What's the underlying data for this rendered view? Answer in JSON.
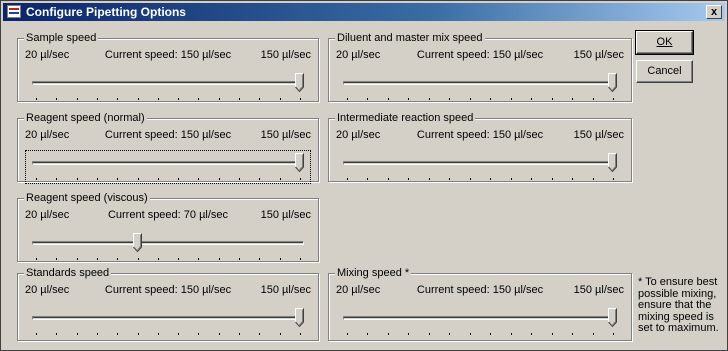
{
  "window": {
    "title": "Configure Pipetting Options",
    "close_label": "x"
  },
  "buttons": {
    "ok_label": "OK",
    "cancel_label": "Cancel"
  },
  "sliders": [
    {
      "id": "sample",
      "label": "Sample speed",
      "min": "20 µl/sec",
      "current": "Current speed: 150 µl/sec",
      "max": "150 µl/sec",
      "value": 150,
      "range": [
        20,
        150
      ],
      "focused": false
    },
    {
      "id": "diluent",
      "label": "Diluent and master mix speed",
      "min": "20 µl/sec",
      "current": "Current speed: 150 µl/sec",
      "max": "150 µl/sec",
      "value": 150,
      "range": [
        20,
        150
      ],
      "focused": false
    },
    {
      "id": "reagent-normal",
      "label": "Reagent speed (normal)",
      "min": "20 µl/sec",
      "current": "Current speed: 150 µl/sec",
      "max": "150 µl/sec",
      "value": 150,
      "range": [
        20,
        150
      ],
      "focused": true
    },
    {
      "id": "intermediate",
      "label": "Intermediate reaction speed",
      "min": "20 µl/sec",
      "current": "Current speed: 150 µl/sec",
      "max": "150 µl/sec",
      "value": 150,
      "range": [
        20,
        150
      ],
      "focused": false
    },
    {
      "id": "reagent-viscous",
      "label": "Reagent speed (viscous)",
      "min": "20 µl/sec",
      "current": "Current speed: 70 µl/sec",
      "max": "150 µl/sec",
      "value": 70,
      "range": [
        20,
        150
      ],
      "focused": false
    },
    {
      "id": "standards",
      "label": "Standards speed",
      "min": "20 µl/sec",
      "current": "Current speed: 150 µl/sec",
      "max": "150 µl/sec",
      "value": 150,
      "range": [
        20,
        150
      ],
      "focused": false
    },
    {
      "id": "mixing",
      "label": "Mixing speed *",
      "min": "20 µl/sec",
      "current": "Current speed: 150 µl/sec",
      "max": "150 µl/sec",
      "value": 150,
      "range": [
        20,
        150
      ],
      "focused": false
    }
  ],
  "note": "* To ensure best possible mixing, ensure that the mixing speed is set to maximum."
}
